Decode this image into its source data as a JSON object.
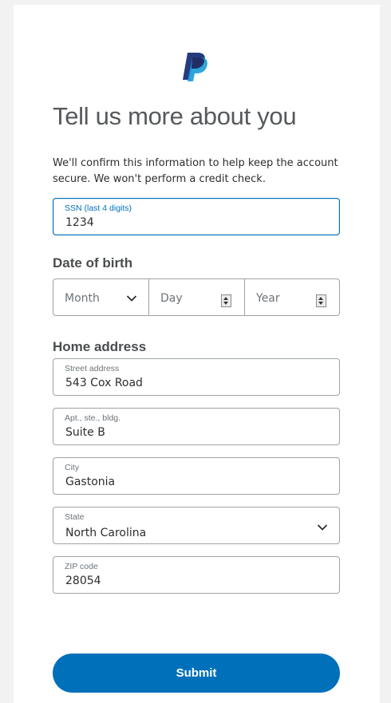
{
  "page": {
    "title": "Tell us more about you",
    "intro": "We'll confirm this information to help keep the account secure. We won't perform a credit check.",
    "brand_colors": {
      "primary": "#0070ba",
      "logo_dark": "#253b80",
      "logo_light": "#179bd7"
    },
    "logo_icon": "paypal-logo-icon"
  },
  "ssn": {
    "label": "SSN (last 4 digits)",
    "value": "1234"
  },
  "dob": {
    "heading": "Date of birth",
    "month": {
      "placeholder": "Month",
      "icon": "chevron-down-icon"
    },
    "day": {
      "placeholder": "Day",
      "icon": "spinner-icon"
    },
    "year": {
      "placeholder": "Year",
      "icon": "spinner-icon"
    }
  },
  "address": {
    "heading": "Home address",
    "street": {
      "label": "Street address",
      "value": "543 Cox Road"
    },
    "apt": {
      "label": "Apt., ste., bldg.",
      "value": "Suite B"
    },
    "city": {
      "label": "City",
      "value": "Gastonia"
    },
    "state": {
      "label": "State",
      "value": "North Carolina",
      "icon": "chevron-down-icon"
    },
    "zip": {
      "label": "ZIP code",
      "value": "28054"
    }
  },
  "submit": {
    "label": "Submit"
  }
}
